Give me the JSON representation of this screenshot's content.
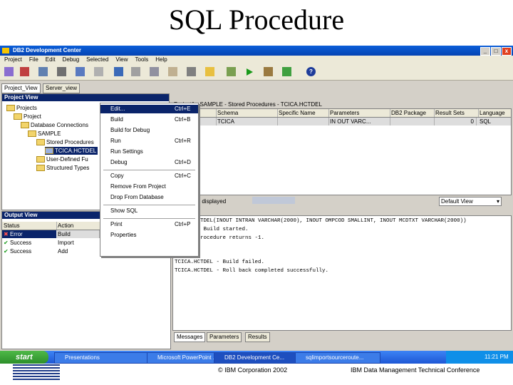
{
  "slide": {
    "title": "SQL Procedure"
  },
  "window": {
    "title": "DB2 Development Center",
    "controls": [
      "_",
      "□",
      "x"
    ]
  },
  "menubar": {
    "items": [
      "Project",
      "File",
      "Edit",
      "Debug",
      "Selected",
      "View",
      "Tools",
      "Help"
    ]
  },
  "left_tabs": [
    "Project_View",
    "Server_view"
  ],
  "project_view": {
    "header": "Project View",
    "tree": [
      {
        "label": "Projects",
        "level": 0
      },
      {
        "label": "Project",
        "level": 1
      },
      {
        "label": "Database Connections",
        "level": 2
      },
      {
        "label": "SAMPLE",
        "level": 3
      },
      {
        "label": "Stored Procedures",
        "level": 4
      },
      {
        "label": "TCICA.HCTDEL",
        "level": 5
      },
      {
        "label": "User-Defined Fu",
        "level": 4
      },
      {
        "label": "Structured Types",
        "level": 4
      }
    ]
  },
  "breadcrumb": "Project1 - SAMPLE - Stored Procedures - TCICA.HCTDEL",
  "details_grid": {
    "columns": [
      "Name",
      "Schema",
      "Specific Name",
      "Parameters",
      "DB2 Package",
      "Result Sets",
      "Language"
    ],
    "rows": [
      [
        "HCTDEL",
        "TCICA",
        "",
        "IN OUT VARC...",
        "",
        "0",
        "SQL"
      ]
    ],
    "status_left": "items displayed",
    "view_select": "Default View"
  },
  "context_menu": {
    "items": [
      {
        "label": "Edit...",
        "shortcut": "Ctrl+E",
        "selected": true
      },
      {
        "label": "Build",
        "shortcut": "Ctrl+B"
      },
      {
        "label": "Build for Debug",
        "shortcut": ""
      },
      {
        "label": "Run",
        "shortcut": "Ctrl+R"
      },
      {
        "label": "Run Settings",
        "shortcut": ""
      },
      {
        "label": "Debug",
        "shortcut": "Ctrl+D"
      },
      {
        "label": "Copy",
        "shortcut": "Ctrl+C",
        "sep_before": true
      },
      {
        "label": "Remove From Project",
        "shortcut": ""
      },
      {
        "label": "Drop From Database",
        "shortcut": ""
      },
      {
        "label": "Show SQL",
        "shortcut": "",
        "sep_before": true
      },
      {
        "label": "Print",
        "shortcut": "Ctrl+P",
        "sep_before": true
      },
      {
        "label": "Properties",
        "shortcut": ""
      }
    ]
  },
  "output_view": {
    "header": "Output View",
    "columns": [
      "Status",
      "Action"
    ],
    "rows": [
      {
        "status": "Error",
        "action": "Build",
        "icon": "error-icon"
      },
      {
        "status": "Success",
        "action": "Import",
        "icon": "check-icon"
      },
      {
        "status": "Success",
        "action": "Add",
        "icon": "check-icon"
      }
    ]
  },
  "message_log": {
    "lines": [
      "TCICA.HCTDEL(INOUT INTRAN VARCHAR(2000), INOUT OMPCOD SMALLINT, INOUT MCDTXT VARCHAR(2000))",
      "HCTDEL - Build started.",
      "Stored procedure returns -1.",
      "",
      "TCICA.HCTDEL - Build failed.",
      "TCICA.HCTDEL - Roll back completed successfully."
    ],
    "tabs": [
      "Messages",
      "Parameters",
      "Results"
    ]
  },
  "taskbar": {
    "start": "start",
    "tasks": [
      "Presentations",
      "Microsoft PowerPoint ...",
      "DB2 Development Ce...",
      "sqlimportsourceroute..."
    ],
    "clock": "11:21 PM"
  },
  "footer": {
    "logo": "IBM",
    "copyright": "© IBM Corporation 2002",
    "conference": "IBM Data Management Technical Conference"
  },
  "colors": {
    "selection": "#0a246a",
    "title_blue": "#0543b3",
    "taskbar_green": "#2c8f2a"
  }
}
